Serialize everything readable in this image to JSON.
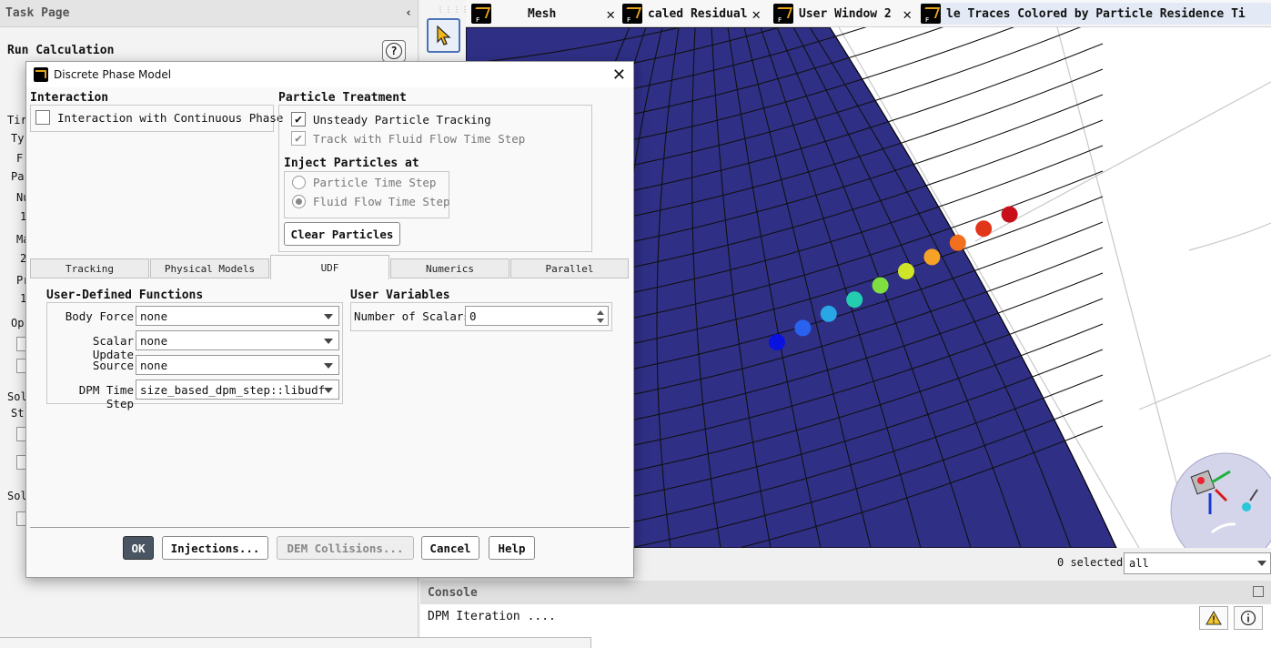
{
  "task_page": {
    "header": "Task Page",
    "collapse_glyph": "‹",
    "title": "Run Calculation",
    "help_glyph": "?",
    "fragments": [
      "Tir",
      "Ty",
      "F:",
      "Pa",
      "Nu",
      "1",
      "Ma",
      "2",
      "Pr",
      "1",
      "Op",
      "Sol",
      "St",
      "Sol"
    ]
  },
  "graphics_tabs": [
    {
      "label": "Mesh",
      "active": false
    },
    {
      "label": "caled Residual",
      "active": false
    },
    {
      "label": "User Window 2",
      "active": false
    },
    {
      "label": "le Traces Colored by Particle Residence Ti",
      "active": true
    }
  ],
  "colors": {
    "mesh_fill": "#2f2f86",
    "accent": "#4a73b8",
    "particles": [
      "#0a12e0",
      "#2a62f0",
      "#28a6e6",
      "#22cdb0",
      "#7ee040",
      "#cfe628",
      "#f5a226",
      "#f26f1e",
      "#e2361a",
      "#c8101a"
    ]
  },
  "selection": {
    "count_label": "0 selected",
    "filter_value": "all"
  },
  "console": {
    "title": "Console",
    "text": "DPM Iteration ...."
  },
  "dialog": {
    "title": "Discrete Phase Model",
    "close_glyph": "✕",
    "interaction": {
      "title": "Interaction",
      "continuous_phase_label": "Interaction with Continuous Phase",
      "continuous_phase_checked": false
    },
    "particle_treatment": {
      "title": "Particle Treatment",
      "unsteady_label": "Unsteady Particle Tracking",
      "unsteady_checked": true,
      "track_label": "Track with Fluid Flow Time Step",
      "track_checked": true,
      "inject_title": "Inject Particles at",
      "inject_options": [
        "Particle Time Step",
        "Fluid Flow Time Step"
      ],
      "inject_selected": "Fluid Flow Time Step",
      "clear_button": "Clear Particles"
    },
    "tabs": [
      "Tracking",
      "Physical Models",
      "UDF",
      "Numerics",
      "Parallel"
    ],
    "active_tab": "UDF",
    "udf": {
      "title": "User-Defined Functions",
      "rows": [
        {
          "label": "Body Force",
          "value": "none"
        },
        {
          "label": "Scalar Update",
          "value": "none"
        },
        {
          "label": "Source",
          "value": "none"
        },
        {
          "label": "DPM Time Step",
          "value": "size_based_dpm_step::libudf"
        }
      ]
    },
    "user_variables": {
      "title": "User Variables",
      "scalars_label": "Number of Scalars",
      "scalars_value": "0"
    },
    "buttons": {
      "ok": "OK",
      "injections": "Injections...",
      "dem": "DEM Collisions...",
      "cancel": "Cancel",
      "help": "Help"
    }
  }
}
